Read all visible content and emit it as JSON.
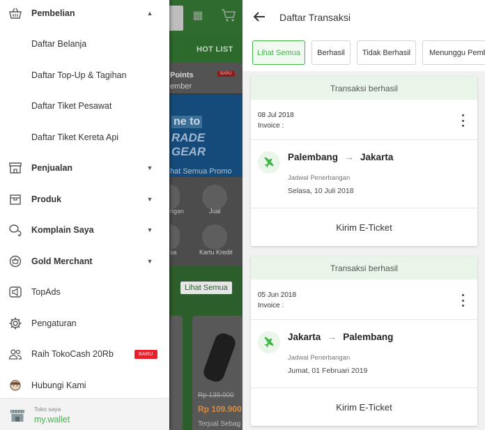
{
  "drawer": {
    "items": [
      {
        "label": "Pembelian",
        "bold": true,
        "icon": "basket-icon",
        "chevron": "up"
      },
      {
        "label": "Daftar Belanja",
        "bold": false
      },
      {
        "label": "Daftar Top-Up & Tagihan",
        "bold": false
      },
      {
        "label": "Daftar Tiket Pesawat",
        "bold": false
      },
      {
        "label": "Daftar Tiket Kereta Api",
        "bold": false
      },
      {
        "label": "Penjualan",
        "bold": true,
        "icon": "store-icon",
        "chevron": "down"
      },
      {
        "label": "Produk",
        "bold": true,
        "icon": "box-icon",
        "chevron": "down"
      },
      {
        "label": "Komplain Saya",
        "bold": true,
        "icon": "chat-bubbles-icon",
        "chevron": "down"
      },
      {
        "label": "Gold Merchant",
        "bold": true,
        "icon": "gold-badge-icon",
        "chevron": "down"
      },
      {
        "label": "TopAds",
        "bold": false,
        "icon": "megaphone-icon"
      },
      {
        "label": "Pengaturan",
        "bold": false,
        "icon": "gear-icon"
      },
      {
        "label": "Raih TokoCash 20Rb",
        "bold": false,
        "icon": "users-icon",
        "badge": "BARU"
      },
      {
        "label": "Hubungi Kami",
        "bold": false,
        "icon": "support-agent-icon"
      }
    ],
    "footer": {
      "subtitle": "Toko saya",
      "title": "my.wallet"
    }
  },
  "background_app": {
    "tab_hotlist": "HOT LIST",
    "points": "Points",
    "member": "ember",
    "baru": "BARU",
    "banner_line1": "ne to",
    "banner_line2": "RADE",
    "banner_line3": "GEAR",
    "promo_link": "hat Semua Promo",
    "icon_label_left1": "ngan",
    "icon_label_jual": "Jual",
    "icon_label_left2": "sa",
    "icon_label_kartu": "Kartu Kredit",
    "lihat_semua": "Lihat Semua",
    "old_price": "Rp 139.900",
    "price": "Rp 109.900",
    "sold": "Terjual Sebag"
  },
  "transactions_page": {
    "title": "Daftar Transaksi",
    "filters": [
      {
        "label": "Lihat Semua",
        "active": true
      },
      {
        "label": "Berhasil",
        "active": false
      },
      {
        "label": "Tidak Berhasil",
        "active": false
      },
      {
        "label": "Menunggu Pembayaran",
        "active": false
      }
    ],
    "cards": [
      {
        "status": "Transaksi berhasil",
        "date": "08 Jul 2018",
        "invoice_label": "Invoice :",
        "from": "Palembang",
        "to": "Jakarta",
        "arrow": "→",
        "schedule_label": "Jadwal Penerbangan",
        "schedule_date": "Selasa, 10 Juli 2018",
        "action": "Kirim E-Ticket"
      },
      {
        "status": "Transaksi berhasil",
        "date": "05 Jun 2018",
        "invoice_label": "Invoice :",
        "from": "Jakarta",
        "to": "Palembang",
        "arrow": "→",
        "schedule_label": "Jadwal Penerbangan",
        "schedule_date": "Jumat, 01 Februari 2019",
        "action": "Kirim E-Ticket"
      }
    ]
  },
  "colors": {
    "accent": "#42b549",
    "status_bg": "#e8f5e8",
    "badge": "#e8202e"
  }
}
